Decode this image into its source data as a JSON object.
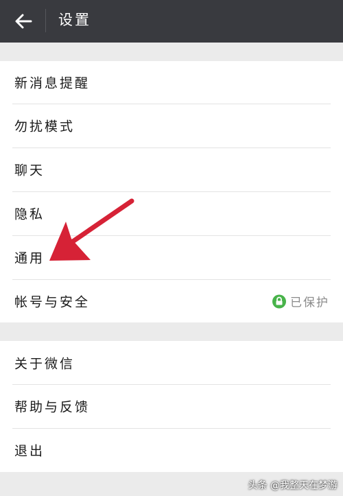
{
  "header": {
    "title": "设置"
  },
  "groups": [
    {
      "items": [
        {
          "label": "新消息提醒"
        },
        {
          "label": "勿扰模式"
        },
        {
          "label": "聊天"
        },
        {
          "label": "隐私"
        },
        {
          "label": "通用"
        },
        {
          "label": "帐号与安全",
          "status": "已保护"
        }
      ]
    },
    {
      "items": [
        {
          "label": "关于微信"
        },
        {
          "label": "帮助与反馈"
        },
        {
          "label": "退出"
        }
      ]
    }
  ],
  "annotation": {
    "color": "#d62236",
    "target": "通用"
  },
  "watermark": "头条 @我整天在梦游",
  "colors": {
    "header_bg": "#393a3f",
    "page_bg": "#ebebeb",
    "lock_green": "#48b34a"
  }
}
